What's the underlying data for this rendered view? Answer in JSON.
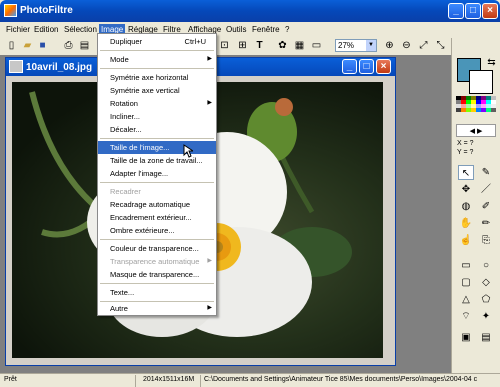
{
  "window": {
    "title": "PhotoFiltre"
  },
  "menubar": [
    "Fichier",
    "Edition",
    "Sélection",
    "Image",
    "Réglage",
    "Filtre",
    "Affichage",
    "Outils",
    "Fenêtre",
    "?"
  ],
  "toolbar": {
    "zoom": "27%"
  },
  "document": {
    "title": "10avril_08.jpg"
  },
  "image_menu": {
    "items": [
      {
        "label": "Dupliquer",
        "shortcut": "Ctrl+U"
      },
      {
        "label": "Mode",
        "submenu": true
      },
      {
        "label": "Symétrie axe horizontal"
      },
      {
        "label": "Symétrie axe vertical"
      },
      {
        "label": "Rotation",
        "submenu": true
      },
      {
        "label": "Incliner..."
      },
      {
        "label": "Décaler..."
      },
      {
        "label": "Taille de l'image...",
        "highlighted": true
      },
      {
        "label": "Taille de la zone de travail..."
      },
      {
        "label": "Adapter l'image..."
      },
      {
        "label": "Recadrer",
        "disabled": true
      },
      {
        "label": "Recadrage automatique"
      },
      {
        "label": "Encadrement extérieur..."
      },
      {
        "label": "Ombre extérieure..."
      },
      {
        "label": "Couleur de transparence..."
      },
      {
        "label": "Transparence automatique",
        "disabled": true,
        "submenu": true
      },
      {
        "label": "Masque de transparence..."
      },
      {
        "label": "Texte..."
      },
      {
        "label": "Autre",
        "submenu": true
      }
    ]
  },
  "palette": {
    "coords_x": "X = ?",
    "coords_y": "Y = ?",
    "fg_color": "#4a95b8",
    "bg_color": "#ffffff"
  },
  "statusbar": {
    "status": "Prêt",
    "dimensions": "2014x1511x16M",
    "path": "C:\\Documents and Settings\\Animateur Tice 85\\Mes documents\\Perso\\Images\\2004-04 c"
  }
}
